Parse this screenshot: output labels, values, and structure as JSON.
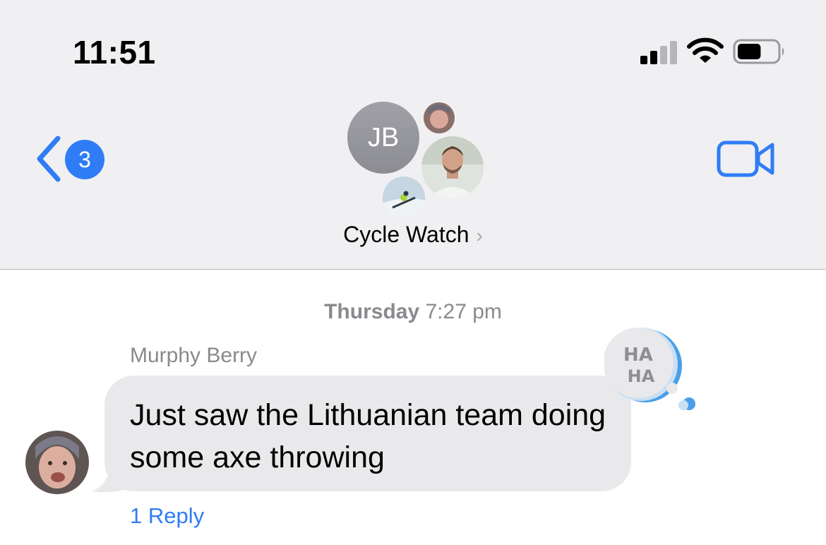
{
  "status_bar": {
    "time": "11:51",
    "signal_icon": "cellular-signal-icon",
    "wifi_icon": "wifi-icon",
    "battery_icon": "battery-icon",
    "battery_level": 0.6
  },
  "nav": {
    "back_icon": "chevron-left-icon",
    "unread_count": "3",
    "video_icon": "video-camera-icon",
    "group_initials": "JB",
    "group_name": "Cycle Watch",
    "chevron": "›",
    "accent_color": "#2f7cf6"
  },
  "thread": {
    "timestamp_day": "Thursday",
    "timestamp_time": "7:27 pm",
    "message": {
      "sender": "Murphy Berry",
      "text": "Just saw the Lithuanian team doing some axe throwing",
      "tapback": "HA HA",
      "reply_label": "1 Reply"
    }
  }
}
